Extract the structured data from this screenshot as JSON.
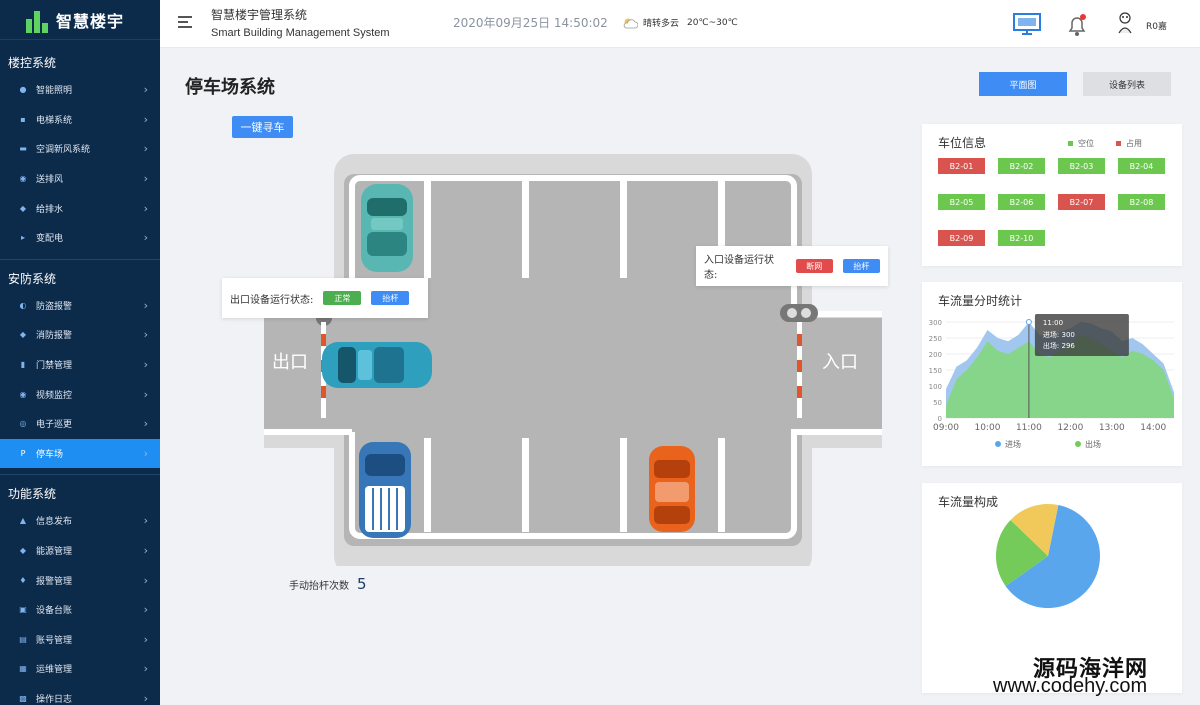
{
  "app": {
    "logo": "智慧楼宇",
    "title": "智慧楼宇管理系统",
    "title_en": "Smart Building Management System",
    "datetime": "2020年09月25日 14:50:02",
    "weather": "晴转多云",
    "temp": "20℃~30℃",
    "user": "R0嘉"
  },
  "sidebar": {
    "groups": [
      {
        "label": "楼控系统",
        "items": [
          {
            "label": "智能照明",
            "icon": "bulb-icon"
          },
          {
            "label": "电梯系统",
            "icon": "elevator-icon"
          },
          {
            "label": "空调新风系统",
            "icon": "ac-icon"
          },
          {
            "label": "送排风",
            "icon": "fan-icon"
          },
          {
            "label": "给排水",
            "icon": "water-icon"
          },
          {
            "label": "变配电",
            "icon": "power-icon"
          }
        ]
      },
      {
        "label": "安防系统",
        "items": [
          {
            "label": "防盗报警",
            "icon": "alarm-icon"
          },
          {
            "label": "消防报警",
            "icon": "fire-icon"
          },
          {
            "label": "门禁管理",
            "icon": "door-icon"
          },
          {
            "label": "视频监控",
            "icon": "camera-icon"
          },
          {
            "label": "电子巡更",
            "icon": "patrol-icon"
          },
          {
            "label": "停车场",
            "icon": "parking-icon",
            "active": true
          }
        ]
      },
      {
        "label": "功能系统",
        "items": [
          {
            "label": "信息发布",
            "icon": "info-icon"
          },
          {
            "label": "能源管理",
            "icon": "energy-icon"
          },
          {
            "label": "报警管理",
            "icon": "bell-icon"
          },
          {
            "label": "设备台账",
            "icon": "device-icon"
          },
          {
            "label": "账号管理",
            "icon": "account-icon"
          },
          {
            "label": "运维管理",
            "icon": "ops-icon"
          },
          {
            "label": "操作日志",
            "icon": "log-icon"
          }
        ]
      }
    ]
  },
  "main": {
    "title": "停车场系统",
    "btn_plan": "平面图",
    "btn_list": "设备列表",
    "btn_find": "一键寻车",
    "exit_label": "出口",
    "entry_label": "入口",
    "exit_status_label": "出口设备运行状态:",
    "exit_status": "正常",
    "exit_lift": "抬杆",
    "entry_status_label": "入口设备运行状态:",
    "entry_status": "断网",
    "entry_lift": "抬杆",
    "manual_label": "手动抬杆次数",
    "manual_count": "5"
  },
  "colors": {
    "free": "#6cc74e",
    "occupied": "#d9534f",
    "blue": "#3e8cf4",
    "sidebar": "#0c2a4a"
  },
  "spaces": {
    "title": "车位信息",
    "legend_free": "空位",
    "legend_occupied": "占用",
    "slots": [
      {
        "id": "B2-01",
        "status": "occupied"
      },
      {
        "id": "B2-02",
        "status": "free"
      },
      {
        "id": "B2-03",
        "status": "free"
      },
      {
        "id": "B2-04",
        "status": "free"
      },
      {
        "id": "B2-05",
        "status": "free"
      },
      {
        "id": "B2-06",
        "status": "free"
      },
      {
        "id": "B2-07",
        "status": "occupied"
      },
      {
        "id": "B2-08",
        "status": "free"
      },
      {
        "id": "B2-09",
        "status": "occupied"
      },
      {
        "id": "B2-10",
        "status": "free"
      }
    ]
  },
  "flow": {
    "title": "车流量分时统计",
    "tooltip": {
      "time": "11:00",
      "in_label": "进场",
      "in": "300",
      "out_label": "出场",
      "out": "296"
    }
  },
  "composition": {
    "title": "车流量构成"
  },
  "chart_data": [
    {
      "type": "area",
      "x": [
        "09:00",
        "09:15",
        "09:30",
        "09:45",
        "10:00",
        "10:15",
        "10:30",
        "10:45",
        "11:00",
        "11:15",
        "11:30",
        "11:45",
        "12:00",
        "12:15",
        "12:30",
        "12:45",
        "13:00",
        "13:15",
        "13:30",
        "13:45",
        "14:00",
        "14:15",
        "14:30"
      ],
      "xticks": [
        "09:00",
        "10:00",
        "11:00",
        "12:00",
        "13:00",
        "14:00"
      ],
      "ylim": [
        0,
        300
      ],
      "yticks": [
        0,
        50,
        100,
        150,
        200,
        250,
        300
      ],
      "series": [
        {
          "name": "进场",
          "color": "#9cc4ee",
          "values": [
            90,
            160,
            180,
            220,
            275,
            250,
            240,
            260,
            300,
            260,
            250,
            270,
            280,
            300,
            295,
            280,
            270,
            240,
            250,
            230,
            200,
            170,
            80
          ]
        },
        {
          "name": "出场",
          "color": "#86d685",
          "values": [
            40,
            120,
            150,
            190,
            240,
            210,
            200,
            220,
            240,
            200,
            190,
            210,
            230,
            260,
            250,
            230,
            210,
            190,
            210,
            200,
            180,
            150,
            60
          ]
        }
      ],
      "legend": "bottom"
    },
    {
      "type": "pie",
      "series": [
        {
          "color": "#5aa6ec",
          "value": 62
        },
        {
          "color": "#74cb5a",
          "value": 22
        },
        {
          "color": "#f0c95a",
          "value": 16
        }
      ]
    }
  ],
  "watermark": {
    "line1": "源码海洋网",
    "line2": "www.codehy.com"
  }
}
